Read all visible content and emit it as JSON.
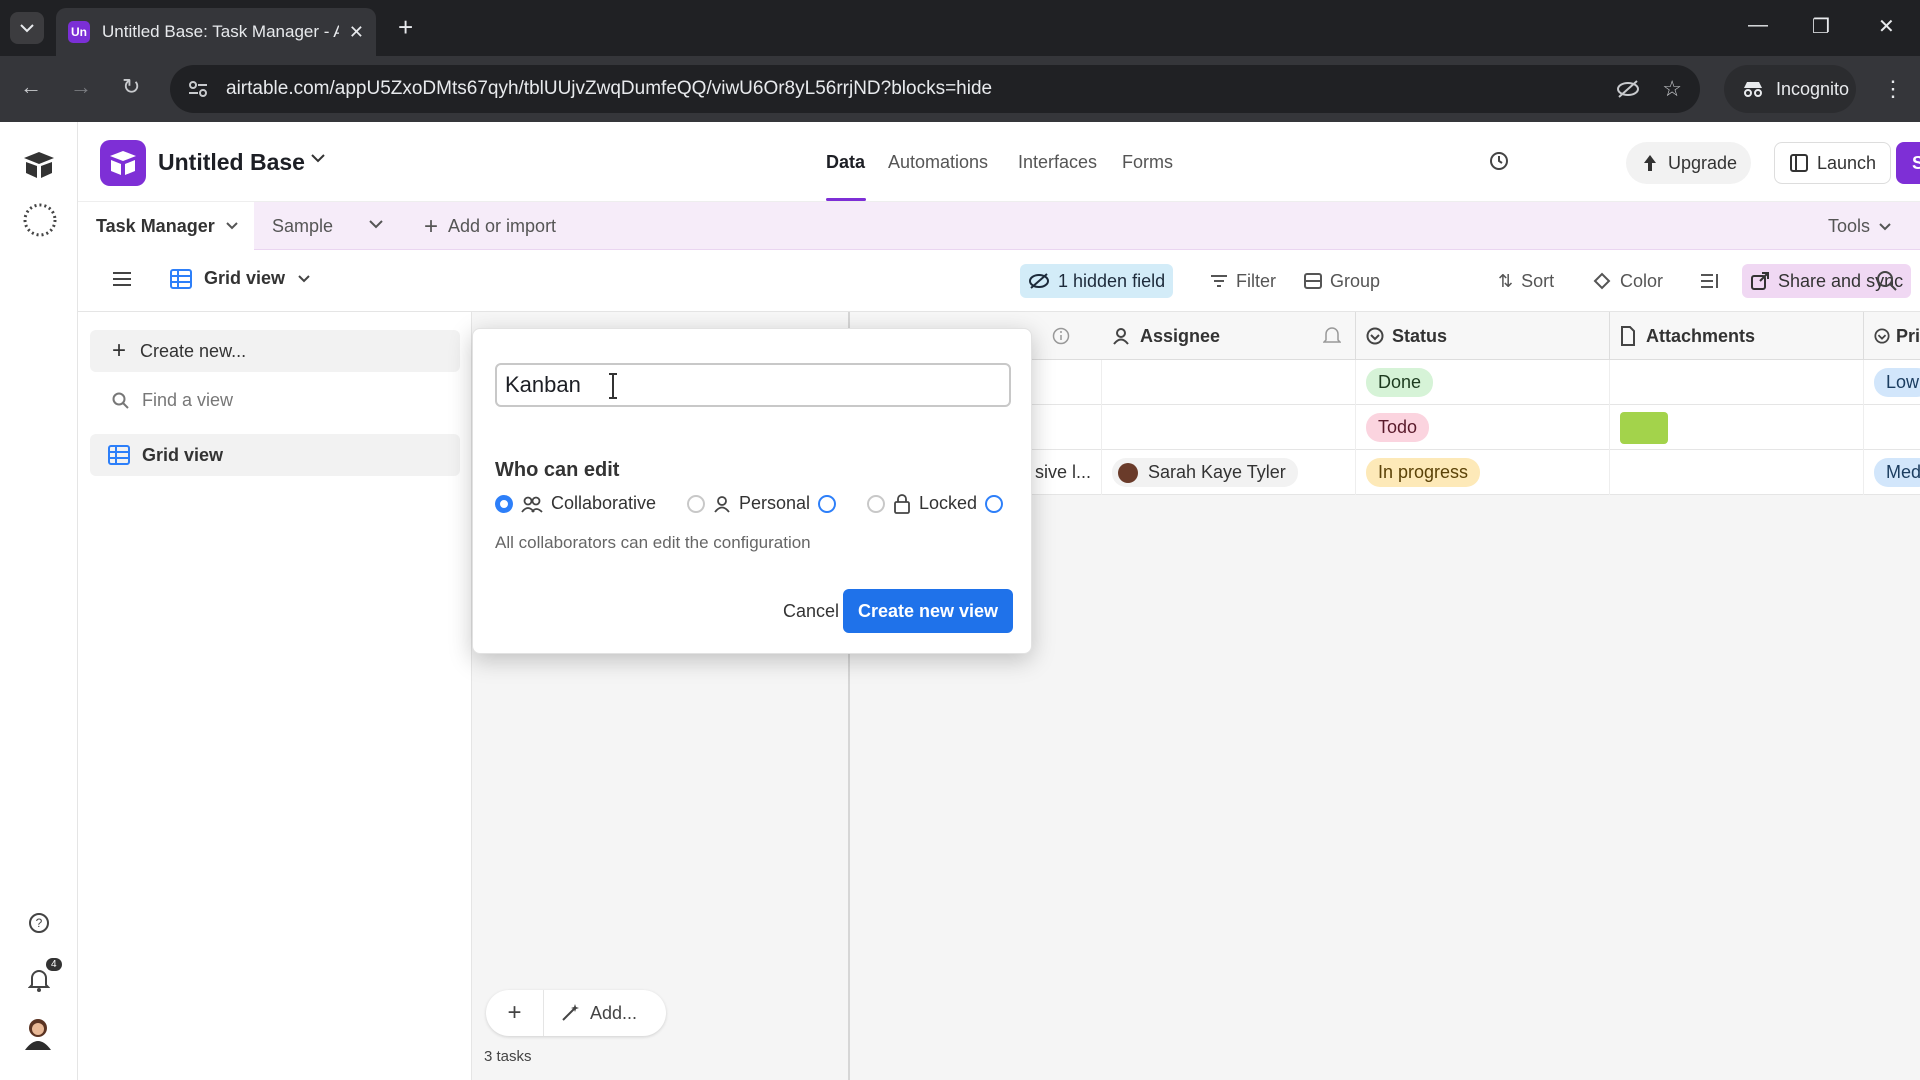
{
  "browser": {
    "tab_title": "Untitled Base: Task Manager - A",
    "favicon_text": "Un",
    "url": "airtable.com/appU5ZxoDMts67qyh/tblUUjvZwqDumfeQQ/viwU6Or8yL56rrjND?blocks=hide",
    "incognito_label": "Incognito"
  },
  "app": {
    "base_name": "Untitled Base",
    "nav_tabs": [
      "Data",
      "Automations",
      "Interfaces",
      "Forms"
    ],
    "upgrade_label": "Upgrade",
    "launch_label": "Launch",
    "share_label": "Share",
    "accent": "#7e2fd6"
  },
  "tables": {
    "active_table": "Task Manager",
    "other_table": "Sample",
    "add_import_label": "Add or import",
    "tools_label": "Tools"
  },
  "viewbar": {
    "current_view": "Grid view",
    "hidden_field_label": "1 hidden field",
    "filter_label": "Filter",
    "group_label": "Group",
    "sort_label": "Sort",
    "color_label": "Color",
    "share_sync_label": "Share and sync"
  },
  "sidebar": {
    "create_new_label": "Create new...",
    "find_placeholder": "Find a view",
    "views": [
      "Grid view"
    ]
  },
  "grid": {
    "columns": [
      "Assignee",
      "Status",
      "Attachments",
      "Pri"
    ],
    "rows": [
      {
        "partial": "",
        "assignee": "",
        "status": "Done",
        "priority": "Low"
      },
      {
        "partial": "",
        "assignee": "",
        "status": "Todo",
        "priority": ""
      },
      {
        "partial": "sive l...",
        "assignee": "Sarah Kaye Tyler",
        "status": "In progress",
        "priority": "Med"
      }
    ],
    "add_label": "Add...",
    "record_count": "3 tasks"
  },
  "dialog": {
    "name_value": "Kanban",
    "who_can_edit_label": "Who can edit",
    "options": [
      "Collaborative",
      "Personal",
      "Locked"
    ],
    "selected_option": "Collaborative",
    "description": "All collaborators can edit the configuration",
    "cancel_label": "Cancel",
    "create_label": "Create new view"
  },
  "rail": {
    "notification_count": "4"
  }
}
